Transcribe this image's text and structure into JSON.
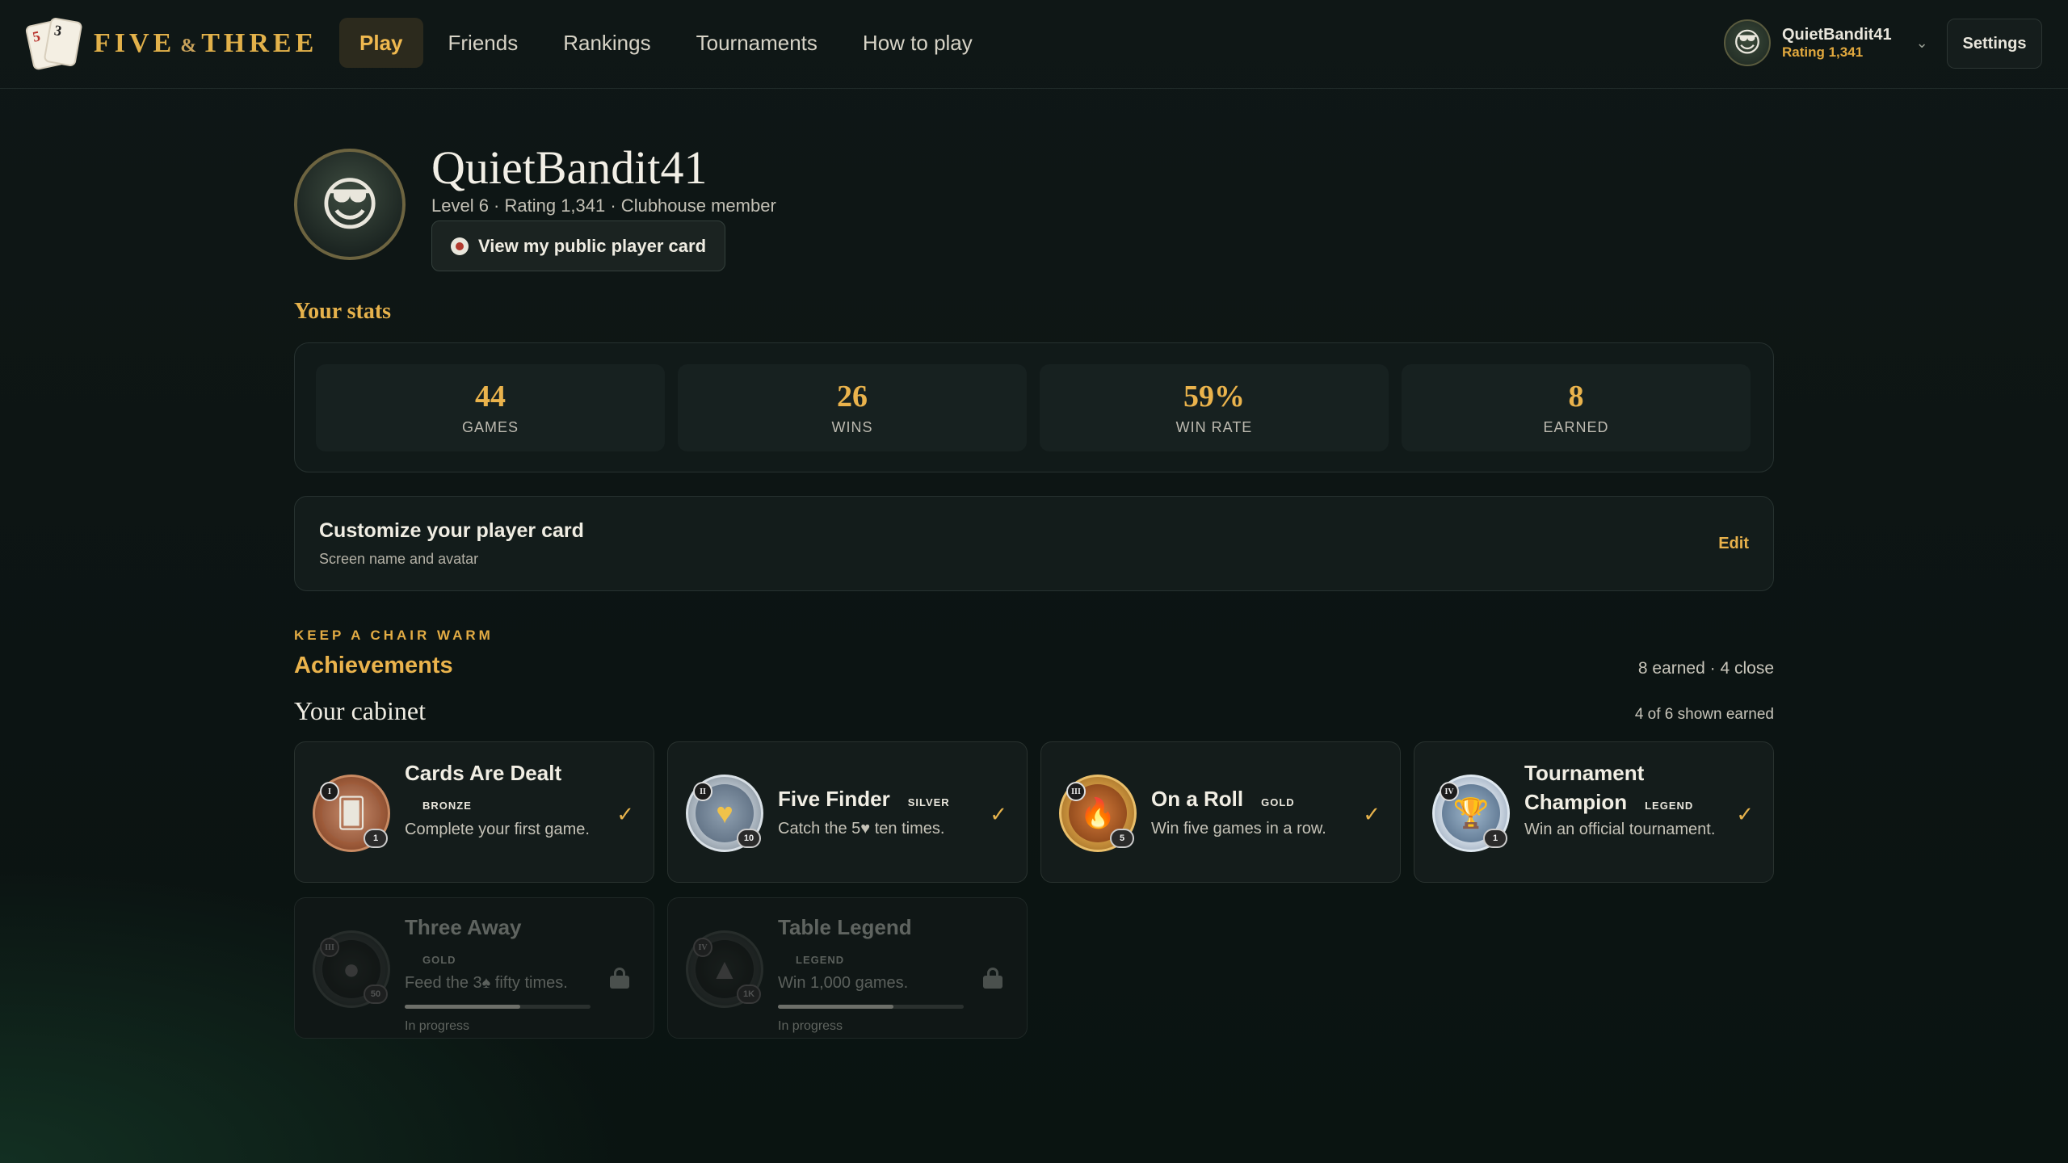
{
  "brand": {
    "name_left": "FIVE",
    "amp": "&",
    "name_right": "THREE",
    "card1": "5",
    "card2": "3"
  },
  "nav": {
    "items": [
      {
        "label": "Play",
        "active": true
      },
      {
        "label": "Friends",
        "active": false
      },
      {
        "label": "Rankings",
        "active": false
      },
      {
        "label": "Tournaments",
        "active": false
      },
      {
        "label": "How to play",
        "active": false
      }
    ]
  },
  "user_chip": {
    "name": "QuietBandit41",
    "rating": "Rating 1,341",
    "avatar": "😎",
    "chevron": "⌄"
  },
  "settings_label": "Settings",
  "profile": {
    "avatar": "😎",
    "name": "QuietBandit41",
    "meta": "Level 6 · Rating 1,341 · Clubhouse member",
    "public_card_label": "View my public player card"
  },
  "stats": {
    "heading": "Your stats",
    "items": [
      {
        "value": "44",
        "label": "GAMES"
      },
      {
        "value": "26",
        "label": "WINS"
      },
      {
        "value": "59%",
        "label": "WIN RATE"
      },
      {
        "value": "8",
        "label": "EARNED"
      }
    ]
  },
  "customize": {
    "title": "Customize your player card",
    "subtitle": "Screen name and avatar",
    "edit_label": "Edit"
  },
  "achievements": {
    "eyebrow": "KEEP A CHAIR WARM",
    "title": "Achievements",
    "summary": "8 earned · 4 close",
    "cabinet_title": "Your cabinet",
    "cabinet_summary": "4 of 6 shown earned",
    "badges": [
      {
        "name": "Cards Are Dealt",
        "tier": "BRONZE",
        "desc": "Complete your first game.",
        "tier_roman": "I",
        "count": "1",
        "icon": "🂠",
        "style": "bronze",
        "earned": true
      },
      {
        "name": "Five Finder",
        "tier": "SILVER",
        "desc": "Catch the 5♥ ten times.",
        "tier_roman": "II",
        "count": "10",
        "icon": "♥",
        "style": "silver",
        "earned": true
      },
      {
        "name": "On a Roll",
        "tier": "GOLD",
        "desc": "Win five games in a row.",
        "tier_roman": "III",
        "count": "5",
        "icon": "🔥",
        "style": "gold",
        "earned": true
      },
      {
        "name": "Tournament Champion",
        "tier": "LEGEND",
        "desc": "Win an official tournament.",
        "tier_roman": "IV",
        "count": "1",
        "icon": "🏆",
        "style": "legend",
        "earned": true
      },
      {
        "name": "Three Away",
        "tier": "GOLD",
        "desc": "Feed the 3♠ fifty times.",
        "tier_roman": "III",
        "count": "50",
        "icon": "●",
        "style": "dark",
        "earned": false,
        "progress": 0.62,
        "progress_label": "In progress"
      },
      {
        "name": "Table Legend",
        "tier": "LEGEND",
        "desc": "Win 1,000 games.",
        "tier_roman": "IV",
        "count": "1K",
        "icon": "▲",
        "style": "dark",
        "earned": false,
        "progress": 0.62,
        "progress_label": "In progress"
      }
    ],
    "check_glyph": "✓"
  },
  "colors": {
    "accent": "#e6b24c",
    "background": "#0f1716",
    "panel": "#141c1b"
  }
}
